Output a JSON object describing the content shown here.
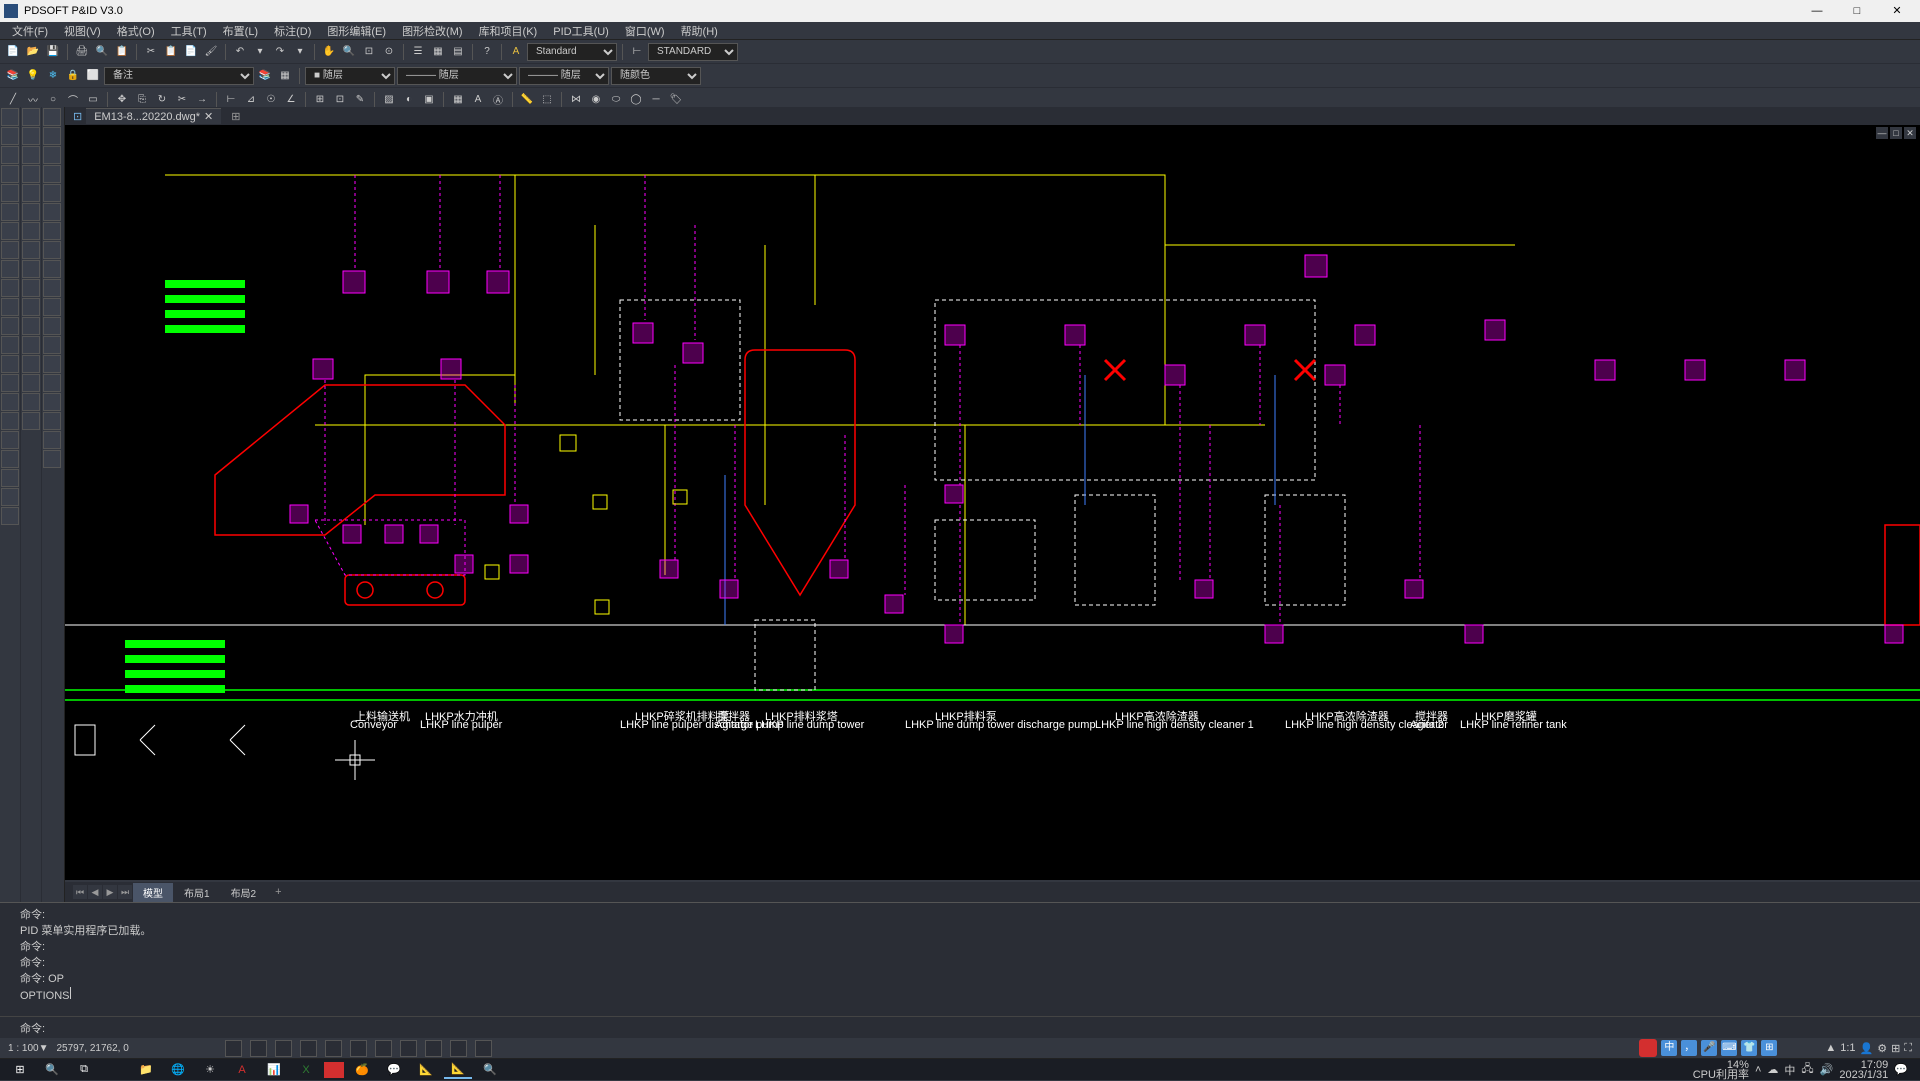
{
  "app": {
    "title": "PDSOFT P&ID V3.0"
  },
  "menus": [
    "文件(F)",
    "视图(V)",
    "格式(O)",
    "工具(T)",
    "布置(L)",
    "标注(D)",
    "图形编辑(E)",
    "图形检改(M)",
    "库和项目(K)",
    "PID工具(U)",
    "窗口(W)",
    "帮助(H)"
  ],
  "toolbar": {
    "style_label": "Standard",
    "text_style_label": "STANDARD",
    "layer_label": "备注",
    "linetype1": "随层",
    "linetype2": "随层",
    "linetype3": "随层",
    "color_label": "随颜色"
  },
  "file_tab": {
    "name": "EM13-8...20220.dwg*"
  },
  "layout_tabs": {
    "model": "模型",
    "l1": "布局1",
    "l2": "布局2"
  },
  "command": {
    "hist1": "命令:",
    "hist2": "PID 菜单实用程序已加载。",
    "hist3": "命令:",
    "hist4": "命令:",
    "hist5": "命令: OP",
    "hist6": "OPTIONS",
    "prompt": "命令:"
  },
  "status": {
    "scale": "1 : 100▼",
    "coords": "25797, 21762, 0",
    "annoscale": "1:1",
    "cpu_pct": "14%",
    "cpu_label": "CPU利用率",
    "time": "17:09",
    "date": "2023/1/31",
    "ime_char": "中"
  }
}
